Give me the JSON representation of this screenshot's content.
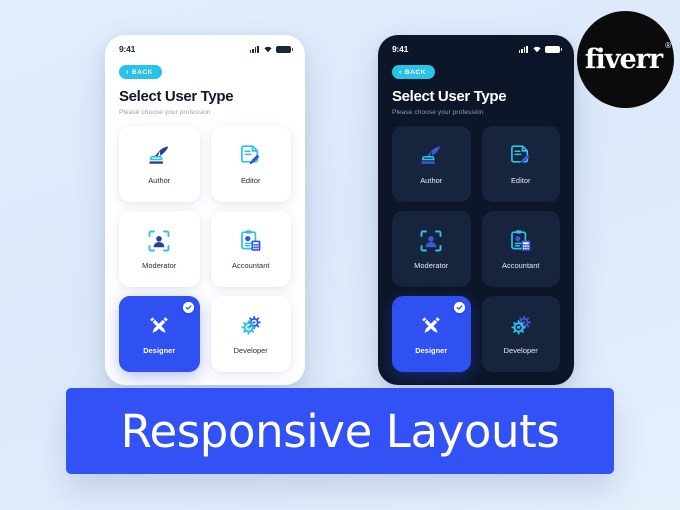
{
  "banner": {
    "text": "Responsive Layouts",
    "color": "#3352f5"
  },
  "brand": {
    "name": "fiverr",
    "registered_mark": "®",
    "circle_color": "#0b0b0b"
  },
  "colors": {
    "page_background": "#dfeafb",
    "accent_blue": "#2f51f2",
    "accent_cyan": "#29c3e8",
    "dark_phone_bg": "#0c1628",
    "dark_card_bg": "#17243d"
  },
  "phones": [
    {
      "theme": "light",
      "status_bar": {
        "time": "9:41",
        "icons": [
          "cellular-signal-icon",
          "wifi-icon",
          "battery-icon"
        ]
      },
      "back_button": {
        "label": "BACK",
        "chevron": "‹"
      },
      "title": "Select User Type",
      "subtitle": "Please choose your profession",
      "cards": [
        {
          "label": "Author",
          "icon": "quill-pen-icon",
          "selected": false
        },
        {
          "label": "Editor",
          "icon": "document-pencil-icon",
          "selected": false
        },
        {
          "label": "Moderator",
          "icon": "user-scan-icon",
          "selected": false
        },
        {
          "label": "Accountant",
          "icon": "clipboard-calculator-icon",
          "selected": false
        },
        {
          "label": "Designer",
          "icon": "design-tools-icon",
          "selected": true
        },
        {
          "label": "Developer",
          "icon": "gears-icon",
          "selected": false
        }
      ]
    },
    {
      "theme": "dark",
      "status_bar": {
        "time": "9:41",
        "icons": [
          "cellular-signal-icon",
          "wifi-icon",
          "battery-icon"
        ]
      },
      "back_button": {
        "label": "BACK",
        "chevron": "‹"
      },
      "title": "Select User Type",
      "subtitle": "Please choose your profession",
      "cards": [
        {
          "label": "Author",
          "icon": "quill-pen-icon",
          "selected": false
        },
        {
          "label": "Editor",
          "icon": "document-pencil-icon",
          "selected": false
        },
        {
          "label": "Moderator",
          "icon": "user-scan-icon",
          "selected": false
        },
        {
          "label": "Accountant",
          "icon": "clipboard-calculator-icon",
          "selected": false
        },
        {
          "label": "Designer",
          "icon": "design-tools-icon",
          "selected": true
        },
        {
          "label": "Developer",
          "icon": "gears-icon",
          "selected": false
        }
      ]
    }
  ]
}
